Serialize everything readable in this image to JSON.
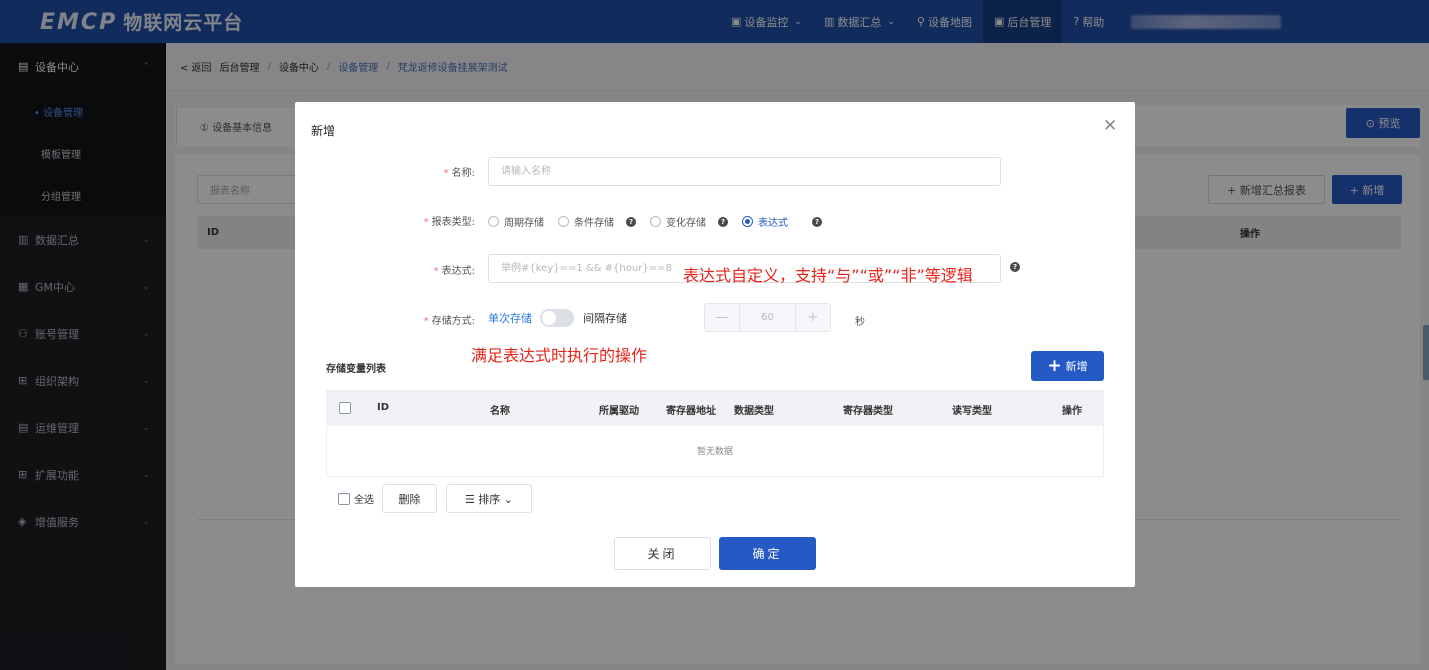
{
  "brand": {
    "logo_mark": "EMCP",
    "logo_text": "物联网云平台"
  },
  "topnav": [
    {
      "icon": "▣",
      "label": "设备监控",
      "chevron": "⌄"
    },
    {
      "icon": "▥",
      "label": "数据汇总",
      "chevron": "⌄"
    },
    {
      "icon": "⚲",
      "label": "设备地图",
      "chevron": ""
    },
    {
      "icon": "▣",
      "label": "后台管理",
      "chevron": ""
    },
    {
      "icon": "?",
      "label": "帮助",
      "chevron": ""
    }
  ],
  "sidebar": {
    "groups": [
      {
        "icon": "▤",
        "label": "设备中心",
        "arrow": "⌃"
      },
      {
        "icon": "▥",
        "label": "数据汇总",
        "arrow": "⌄"
      },
      {
        "icon": "▦",
        "label": "GM中心",
        "arrow": "⌄"
      },
      {
        "icon": "⚇",
        "label": "账号管理",
        "arrow": "⌄"
      },
      {
        "icon": "⊞",
        "label": "组织架构",
        "arrow": "⌄"
      },
      {
        "icon": "▤",
        "label": "运维管理",
        "arrow": "⌄"
      },
      {
        "icon": "⊞",
        "label": "扩展功能",
        "arrow": "⌄"
      },
      {
        "icon": "◈",
        "label": "增值服务",
        "arrow": "⌄"
      }
    ],
    "subitems": [
      {
        "label": "• 设备管理"
      },
      {
        "label": "模板管理"
      },
      {
        "label": "分组管理"
      }
    ]
  },
  "breadcrumb": {
    "back": "< 返回",
    "items": [
      "后台管理",
      "设备中心",
      "设备管理",
      "梵龙返修设备挂展架测试"
    ],
    "sep": "/"
  },
  "background": {
    "tab_basic": "① 设备基本信息",
    "preview": "⊙ 预览",
    "search_placeholder": "报表名称",
    "add_summary": "+ 新增汇总报表",
    "add": "+ 新增",
    "col_id": "ID",
    "col_op": "操作"
  },
  "modal": {
    "title": "新增",
    "close": "✕",
    "name_label": "名称:",
    "name_placeholder": "请输入名称",
    "type_label": "报表类型:",
    "types": [
      "周期存储",
      "条件存储",
      "变化存储",
      "表达式"
    ],
    "help": "?",
    "expr_label": "表达式:",
    "expr_placeholder": "举例#{key}==1 && #{hour}==8",
    "store_label": "存储方式:",
    "store_single": "单次存储",
    "store_interval": "间隔存储",
    "stepper_minus": "—",
    "stepper_value": "60",
    "stepper_plus": "+",
    "unit": "秒",
    "annotation_expr": "表达式自定义，支持“与”“或”“非”等逻辑",
    "annotation_action": "满足表达式时执行的操作",
    "list_title": "存储变量列表",
    "add_plus": "+",
    "add_label": "新增",
    "columns": [
      "ID",
      "名称",
      "所属驱动",
      "寄存器地址",
      "数据类型",
      "寄存器类型",
      "读写类型",
      "操作"
    ],
    "empty": "暂无数据",
    "select_all": "全选",
    "delete": "删除",
    "sort": "☰ 排序 ⌄",
    "btn_close": "关闭",
    "btn_ok": "确定"
  }
}
